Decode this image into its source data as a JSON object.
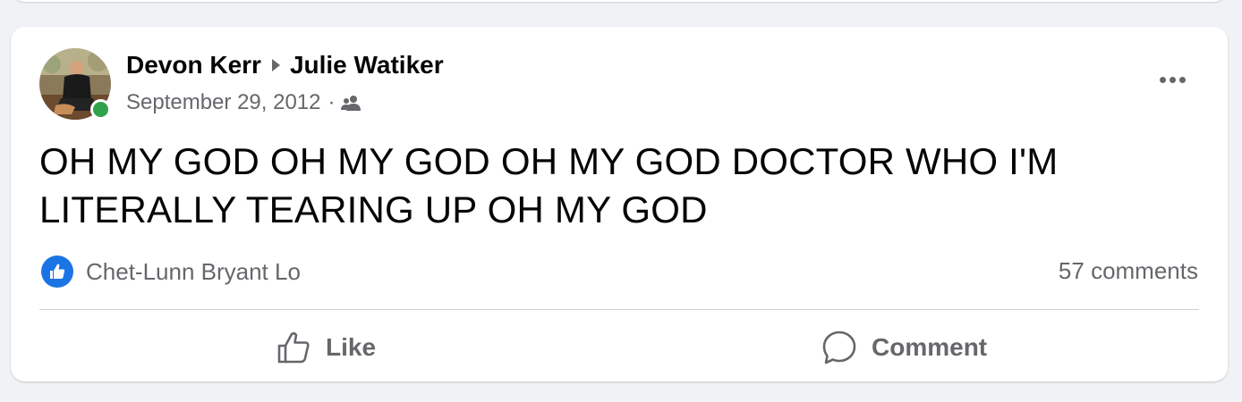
{
  "post": {
    "author": "Devon Kerr",
    "recipient": "Julie Watiker",
    "date": "September 29, 2012",
    "separator": "·",
    "audience_icon": "friends-icon",
    "text": "OH MY GOD OH MY GOD OH MY GOD DOCTOR WHO I'M LITERALLY TEARING UP OH MY GOD",
    "reactions_names": "Chet-Lunn Bryant Lo",
    "comments_count": "57 comments",
    "online_status_color": "#31a24c"
  },
  "actions": {
    "like_label": "Like",
    "comment_label": "Comment"
  },
  "colors": {
    "background": "#f0f2f5",
    "card": "#ffffff",
    "primary_text": "#050505",
    "secondary_text": "#65676b",
    "like_blue": "#1b74e4"
  }
}
